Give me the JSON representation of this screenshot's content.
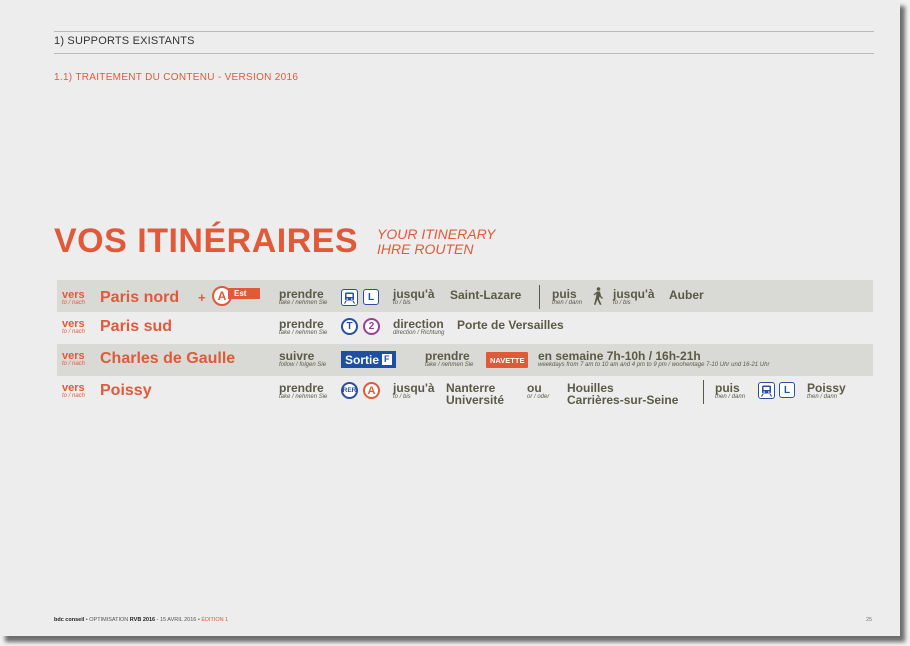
{
  "header": {
    "section": "1) SUPPORTS EXISTANTS",
    "subsection": "1.1) TRAITEMENT DU CONTENU - VERSION 2016"
  },
  "title": {
    "main": "VOS ITINÉRAIRES",
    "en": "YOUR ITINERARY",
    "de": "IHRE ROUTEN"
  },
  "common": {
    "vers": "vers",
    "vers_sub": "to / nach",
    "prendre": "prendre",
    "prendre_sub": "take / nehmen Sie",
    "jusqua": "jusqu'à",
    "jusqua_sub": "to / bis",
    "puis": "puis",
    "puis_sub": "then / dann",
    "plus": "+"
  },
  "rows": [
    {
      "destination": "Paris nord",
      "badge_letter": "A",
      "badge_suffix": "Est",
      "line": "L",
      "stop1": "Saint-Lazare",
      "stop2": "Auber"
    },
    {
      "destination": "Paris sud",
      "tram": "T",
      "tram_line": "2",
      "direction": "direction",
      "direction_sub": "direction / Richtung",
      "stop": "Porte de Versailles"
    },
    {
      "destination": "Charles de Gaulle",
      "suivre": "suivre",
      "suivre_sub": "follow / folgen Sie",
      "sortie": "Sortie",
      "sortie_letter": "F",
      "navette": "NAVETTE",
      "schedule": "en semaine 7h-10h / 16h-21h",
      "schedule_sub": "weekdays from 7 am to 10 am and 4 pm to 9 pm / woohentage 7-10 Uhr und 16-21 Uhr"
    },
    {
      "destination": "Poissy",
      "rer": "RER",
      "rer_line": "A",
      "stop1_l1": "Nanterre",
      "stop1_l2": "Université",
      "ou": "ou",
      "ou_sub": "or / oder",
      "stop2_l1": "Houilles",
      "stop2_l2": "Carrières-sur-Seine",
      "line": "L",
      "stop3": "Poissy"
    }
  ],
  "footer": {
    "brand": "bdc conseil",
    "sep1": " • ",
    "project": "OPTIMISATION",
    "project_bold": " RVB 2016",
    "date": " - 15 AVRIL 2016 • ",
    "edition": "ÉDITION 1",
    "page": "25"
  },
  "colors": {
    "accent": "#e05a3a",
    "olive": "#5a5a46",
    "blue": "#1f4fa3",
    "tram_purple": "#9c3f98",
    "row_shade": "#d9d9d5"
  }
}
